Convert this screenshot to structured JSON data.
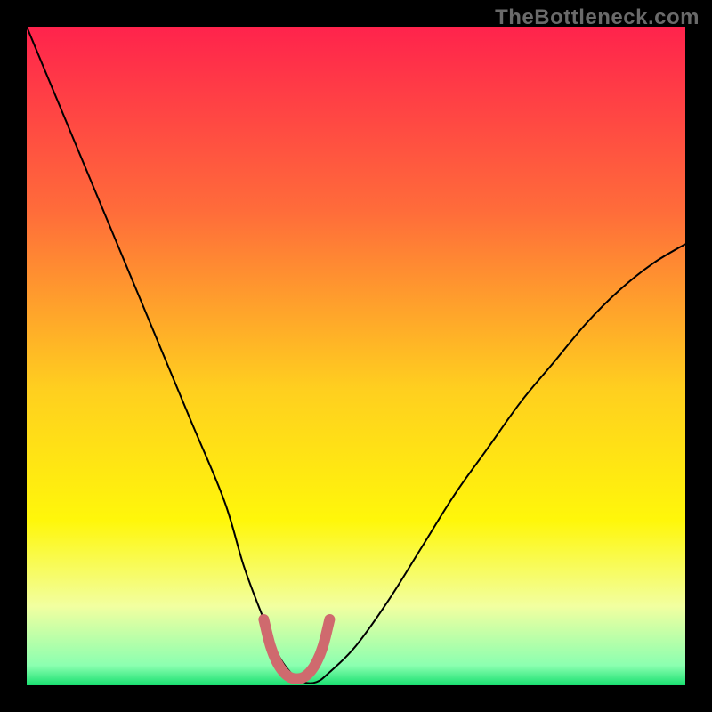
{
  "watermark": "TheBottleneck.com",
  "chart_data": {
    "type": "line",
    "title": "",
    "xlabel": "",
    "ylabel": "",
    "xlim": [
      0,
      100
    ],
    "ylim": [
      0,
      100
    ],
    "grid": false,
    "series": [
      {
        "name": "bottleneck-curve",
        "x": [
          0,
          5,
          10,
          15,
          20,
          25,
          30,
          33,
          36,
          38,
          40,
          42,
          44,
          46,
          50,
          55,
          60,
          65,
          70,
          75,
          80,
          85,
          90,
          95,
          100
        ],
        "y": [
          100,
          88,
          76,
          64,
          52,
          40,
          28,
          18,
          10,
          5,
          2,
          0.5,
          0.5,
          2,
          6,
          13,
          21,
          29,
          36,
          43,
          49,
          55,
          60,
          64,
          67
        ],
        "stroke": "#000000",
        "stroke_width": 2
      },
      {
        "name": "optimal-range-marker",
        "x": [
          36,
          37,
          38,
          39,
          40,
          41,
          42,
          43,
          44,
          45,
          46
        ],
        "y": [
          10,
          6,
          3.5,
          2,
          1.2,
          1,
          1.2,
          2,
          3.5,
          6,
          10
        ],
        "stroke": "#cf6a6e",
        "stroke_width": 12
      }
    ],
    "background_gradient": {
      "stops": [
        {
          "offset": 0.0,
          "color": "#ff234c"
        },
        {
          "offset": 0.28,
          "color": "#ff6c3a"
        },
        {
          "offset": 0.55,
          "color": "#ffcf1f"
        },
        {
          "offset": 0.75,
          "color": "#fff70a"
        },
        {
          "offset": 0.88,
          "color": "#f2ffa0"
        },
        {
          "offset": 0.97,
          "color": "#8bffb0"
        },
        {
          "offset": 1.0,
          "color": "#19e070"
        }
      ]
    }
  }
}
